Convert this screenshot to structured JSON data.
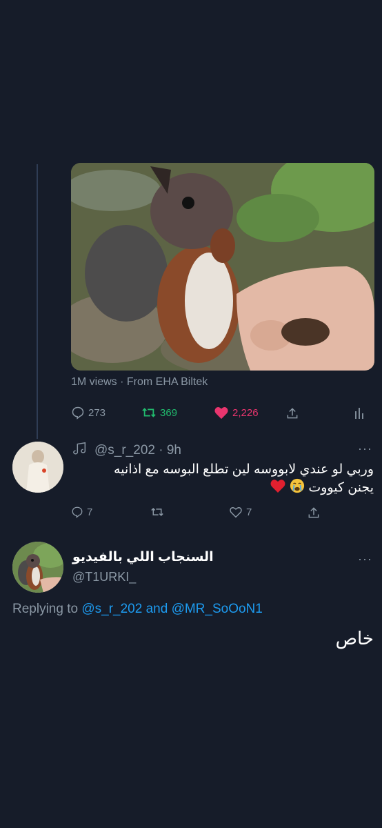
{
  "colors": {
    "background": "#161c29",
    "muted": "#8b98a5",
    "retweet_green": "#21ba6d",
    "like_pink": "#e9356e",
    "link_blue": "#1d9bf0",
    "thread_line": "#2f3d55"
  },
  "main_tweet": {
    "media_meta": "1M views · From EHA Biltek",
    "actions": {
      "replies": "273",
      "retweets": "369",
      "likes": "2,226"
    },
    "icons": [
      "reply-icon",
      "retweet-icon",
      "heart-filled-icon",
      "share-icon",
      "analytics-icon"
    ]
  },
  "reply_tweet": {
    "handle_time": "@s_r_202 · 9h",
    "more": "···",
    "text_line1": "وربي لو عندي لابووسه لين تطلع البوسه مع اذانيه",
    "text_line2": "يجنن كيووت",
    "actions": {
      "replies": "7",
      "retweets": "",
      "likes": "7"
    },
    "icons": [
      "music-note-icon",
      "crying-face-icon",
      "red-heart-icon"
    ]
  },
  "bottom_tweet": {
    "display_name": "السنجاب اللي بالفيديو",
    "handle": "@T1URKI_",
    "more": "···",
    "replying_prefix": "Replying to",
    "replying_mention1": "@s_r_202",
    "replying_and": "and",
    "replying_mention2": "@MR_SoOoN1",
    "text": "خاص"
  }
}
